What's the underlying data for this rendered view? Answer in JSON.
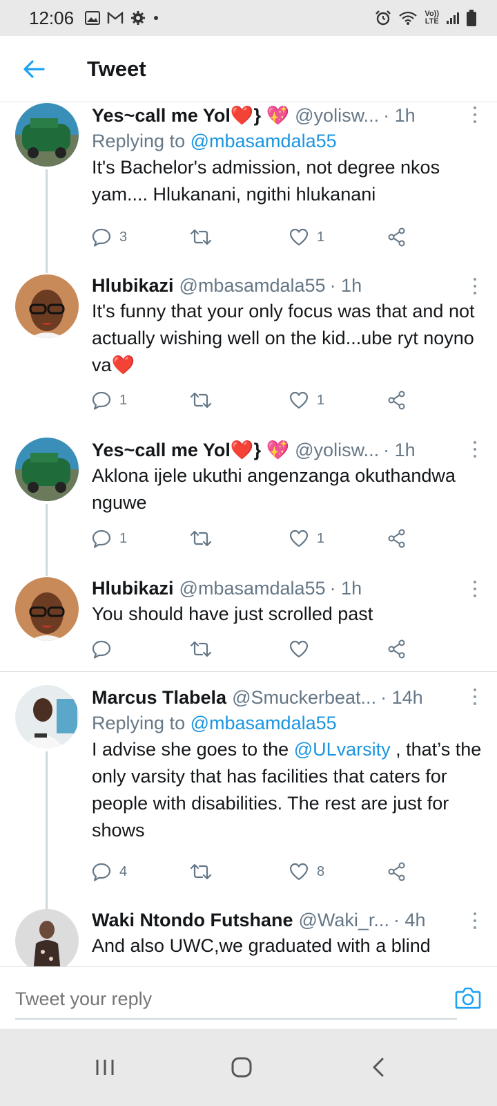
{
  "status_bar": {
    "time": "12:06",
    "lte_top": "Vo))",
    "lte_bottom": "LTE",
    "icons": [
      "image-icon",
      "gmail-icon",
      "settings-icon",
      "dot-icon",
      "alarm-icon",
      "wifi-icon",
      "volte-icon",
      "signal-icon",
      "battery-icon"
    ]
  },
  "header": {
    "title": "Tweet"
  },
  "tweets": [
    {
      "name": "Yes~call me Yol❤️} 💖",
      "handle": "@yolisw...",
      "time": "· 1h",
      "replying_prefix": "Replying to",
      "replying_to": "@mbasamdala55",
      "text": "It's Bachelor's admission, not degree nkos yam.... Hlukanani, ngithi hlukanani",
      "replies": "3",
      "retweets": "",
      "likes": "1"
    },
    {
      "name": "Hlubikazi",
      "handle": "@mbasamdala55",
      "time": "· 1h",
      "text": "It's funny that your only focus was that and not actually wishing well on the kid...ube ryt noyno va❤️",
      "replies": "1",
      "retweets": "",
      "likes": "1"
    },
    {
      "name": "Yes~call me Yol❤️} 💖",
      "handle": "@yolisw...",
      "time": "· 1h",
      "text": "Aklona ijele ukuthi angenzanga okuthandwa nguwe",
      "replies": "1",
      "retweets": "",
      "likes": "1"
    },
    {
      "name": "Hlubikazi",
      "handle": "@mbasamdala55",
      "time": "· 1h",
      "text": "You should have just scrolled past",
      "replies": "",
      "retweets": "",
      "likes": ""
    },
    {
      "name": "Marcus Tlabela",
      "handle": "@Smuckerbeat...",
      "time": "· 14h",
      "replying_prefix": "Replying to",
      "replying_to": "@mbasamdala55",
      "text_before": "I advise she goes to the ",
      "text_mention": "@ULvarsity",
      "text_after": " , that’s the only varsity that has facilities that caters for people with disabilities. The rest are just for shows",
      "replies": "4",
      "retweets": "",
      "likes": "8"
    },
    {
      "name": "Waki Ntondo Futshane",
      "handle": "@Waki_r...",
      "time": "· 4h",
      "text": "And also UWC,we graduated with a blind"
    }
  ],
  "reply_bar": {
    "placeholder": "Tweet your reply"
  },
  "nav": {
    "icons": [
      "recents-icon",
      "home-icon",
      "back-icon"
    ]
  },
  "colors": {
    "accent": "#1da1f2",
    "secondary_text": "#657786",
    "divider": "#dfe3e6",
    "system_bar": "#e9e9ea"
  }
}
